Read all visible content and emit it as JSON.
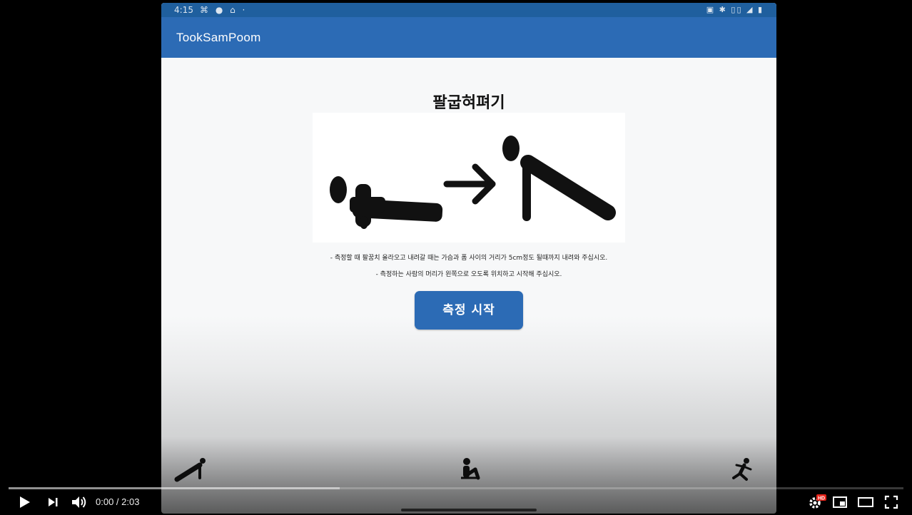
{
  "status_bar": {
    "time": "4:15",
    "left_icons": "⌘ ● ⌂ ·",
    "right_icons": "▣ ✱ ▯▯ ◢ ▮"
  },
  "app": {
    "title": "TookSamPoom"
  },
  "exercise": {
    "title": "팔굽혀펴기",
    "instructions": [
      "- 측정할 때 팔꿈치 올라오고 내려갈 때는 가슴과 폼 사이의 거리가 5cm정도 될때까지 내려와 주십시오.",
      "- 측정하는 사람의 머리가 왼쪽으로 오도록 위치하고 시작해 주십시오."
    ]
  },
  "start_button": {
    "label": "측정 시작"
  },
  "bottom_nav": {
    "items": [
      "pushup-icon",
      "situp-icon",
      "running-icon"
    ]
  },
  "video_player": {
    "current_time": "0:00",
    "duration": "2:03",
    "time_label": "0:00 / 2:03",
    "played_fraction": 0.0,
    "buffered_fraction": 0.37,
    "quality_badge": "HD",
    "progress_color": "#ff0000"
  }
}
